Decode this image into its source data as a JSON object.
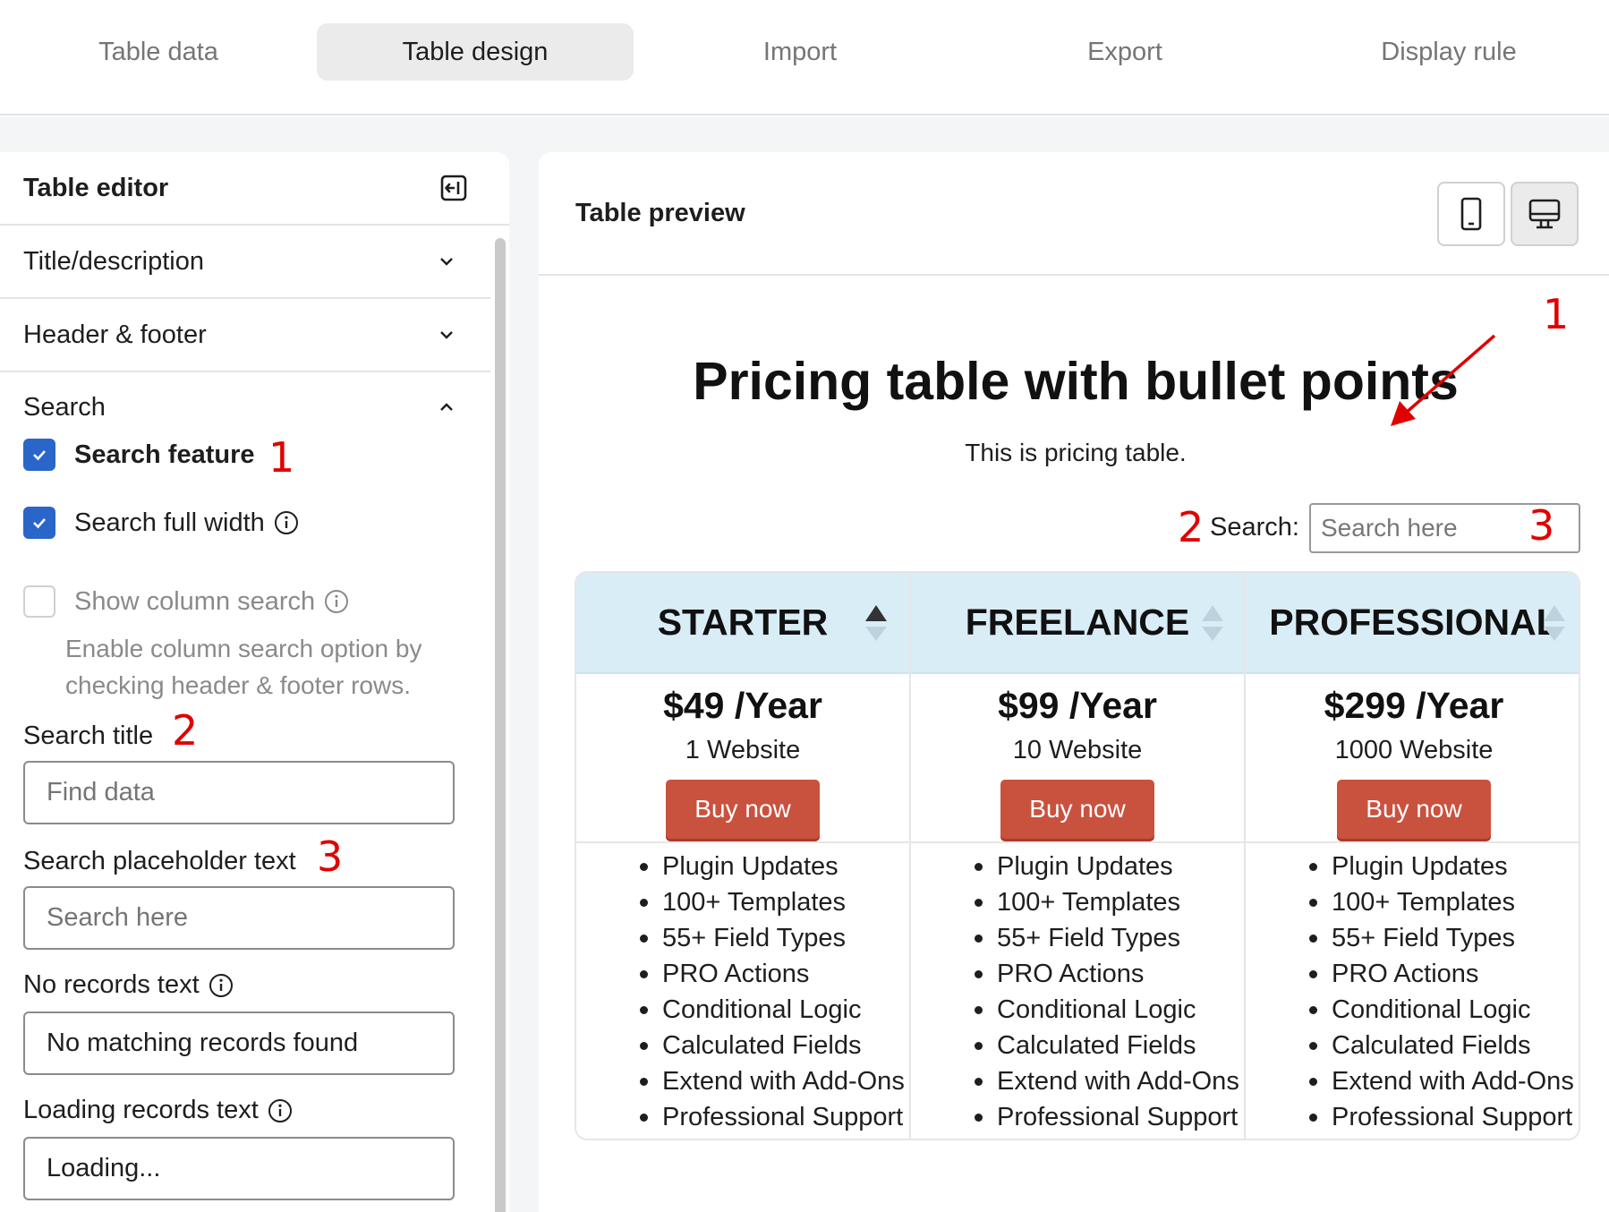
{
  "tabs": [
    {
      "label": "Table data"
    },
    {
      "label": "Table design",
      "active": true
    },
    {
      "label": "Import"
    },
    {
      "label": "Export"
    },
    {
      "label": "Display rule"
    }
  ],
  "editor": {
    "title": "Table editor",
    "sections": {
      "title_description": "Title/description",
      "header_footer": "Header & footer",
      "search": "Search"
    },
    "search_feature": {
      "label": "Search feature",
      "checked": true
    },
    "search_full_width": {
      "label": "Search full width",
      "checked": true
    },
    "show_column_search": {
      "label": "Show column search",
      "checked": false
    },
    "column_search_help": "Enable column search option by checking header & footer rows.",
    "search_title": {
      "label": "Search title",
      "placeholder": "Find data"
    },
    "search_placeholder": {
      "label": "Search placeholder text",
      "placeholder": "Search here"
    },
    "no_records": {
      "label": "No records text",
      "value": "No matching records found"
    },
    "loading_records": {
      "label": "Loading records text",
      "value": "Loading..."
    }
  },
  "preview": {
    "title": "Table preview",
    "device_buttons": [
      "mobile-icon",
      "desktop-icon"
    ],
    "table_title": "Pricing table with bullet points",
    "table_description": "This is pricing table.",
    "search_label": "Search:",
    "search_placeholder": "Search here",
    "plans": [
      {
        "name": "STARTER",
        "price": "$49 /Year",
        "sites": "1 Website",
        "button": "Buy now"
      },
      {
        "name": "FREELANCE",
        "price": "$99 /Year",
        "sites": "10 Website",
        "button": "Buy now"
      },
      {
        "name": "PROFESSIONAL",
        "price": "$299 /Year",
        "sites": "1000 Website",
        "button": "Buy now"
      }
    ],
    "features": [
      "Plugin Updates",
      "100+ Templates",
      "55+ Field Types",
      "PRO Actions",
      "Conditional Logic",
      "Calculated Fields",
      "Extend with Add-Ons",
      "Professional Support"
    ]
  },
  "annotations": {
    "one": "1",
    "two": "2",
    "three": "3"
  },
  "colors": {
    "accent": "#2a66c9",
    "buy_button": "#c9523f",
    "header_bg": "#d9edf7",
    "annotation": "#e00000"
  }
}
